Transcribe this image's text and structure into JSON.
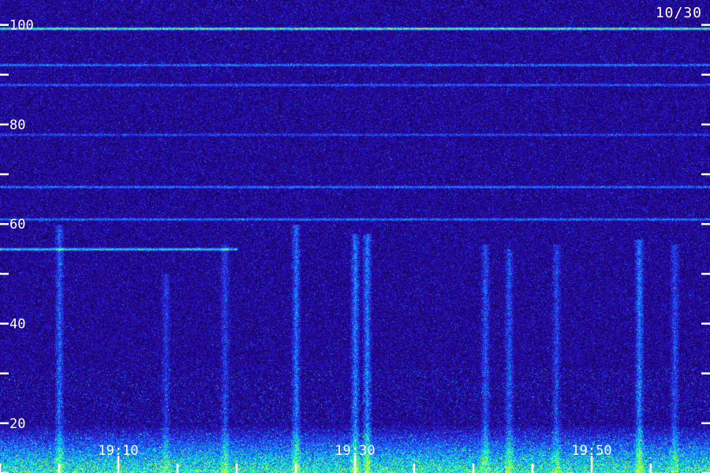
{
  "chart_data": {
    "type": "heatmap",
    "title": "",
    "date_label": "10/30",
    "xlabel": "",
    "ylabel": "",
    "x_ticks": [
      {
        "value": "19:00",
        "label": ""
      },
      {
        "value": "19:05",
        "label": ""
      },
      {
        "value": "19:10",
        "label": "19:10"
      },
      {
        "value": "19:15",
        "label": ""
      },
      {
        "value": "19:20",
        "label": ""
      },
      {
        "value": "19:25",
        "label": ""
      },
      {
        "value": "19:30",
        "label": "19:30"
      },
      {
        "value": "19:35",
        "label": ""
      },
      {
        "value": "19:40",
        "label": ""
      },
      {
        "value": "19:45",
        "label": ""
      },
      {
        "value": "19:50",
        "label": "19:50"
      },
      {
        "value": "19:55",
        "label": ""
      }
    ],
    "xlim": [
      "19:00",
      "19:58"
    ],
    "y_ticks": [
      {
        "value": 10,
        "label": ""
      },
      {
        "value": 20,
        "label": "20"
      },
      {
        "value": 30,
        "label": ""
      },
      {
        "value": 40,
        "label": "40"
      },
      {
        "value": 50,
        "label": ""
      },
      {
        "value": 60,
        "label": "60"
      },
      {
        "value": 70,
        "label": ""
      },
      {
        "value": 80,
        "label": "80"
      },
      {
        "value": 90,
        "label": ""
      },
      {
        "value": 100,
        "label": "100"
      }
    ],
    "ylim": [
      10,
      105
    ],
    "colormap": [
      "#000000",
      "#1a0060",
      "#2a10c0",
      "#1f5cff",
      "#00c8ff",
      "#20ff90",
      "#d8ff40"
    ],
    "grid": false,
    "features": {
      "horizontal_lines": [
        {
          "y": 99.3,
          "strength": 0.75
        },
        {
          "y": 92,
          "strength": 0.35
        },
        {
          "y": 88,
          "strength": 0.3
        },
        {
          "y": 78,
          "strength": 0.25
        },
        {
          "y": 67.5,
          "strength": 0.35
        },
        {
          "y": 61,
          "strength": 0.35
        },
        {
          "y": 55,
          "strength": 0.6,
          "x_end": "19:20"
        }
      ],
      "vertical_bursts": [
        {
          "x": "19:05",
          "y_top": 60,
          "strength": 0.45
        },
        {
          "x": "19:14",
          "y_top": 50,
          "strength": 0.3
        },
        {
          "x": "19:19",
          "y_top": 56,
          "strength": 0.35
        },
        {
          "x": "19:25",
          "y_top": 60,
          "strength": 0.5
        },
        {
          "x": "19:30",
          "y_top": 58,
          "strength": 0.55
        },
        {
          "x": "19:31",
          "y_top": 58,
          "strength": 0.55
        },
        {
          "x": "19:41",
          "y_top": 56,
          "strength": 0.4
        },
        {
          "x": "19:43",
          "y_top": 55,
          "strength": 0.4
        },
        {
          "x": "19:47",
          "y_top": 56,
          "strength": 0.35
        },
        {
          "x": "19:54",
          "y_top": 57,
          "strength": 0.55
        },
        {
          "x": "19:57",
          "y_top": 56,
          "strength": 0.35
        }
      ],
      "low_frequency_band": {
        "y_from": 10,
        "y_to": 20,
        "strength": 0.8
      }
    }
  }
}
